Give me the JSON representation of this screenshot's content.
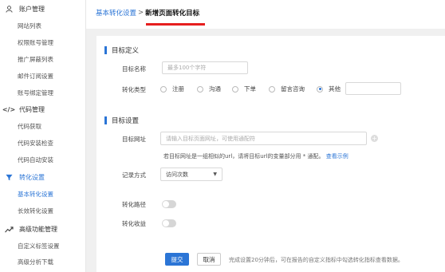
{
  "sidebar": {
    "sections": [
      {
        "label": "账户管理",
        "icon": "user-icon",
        "items": [
          "网站列表",
          "权限账号管理",
          "推广屏蔽列表",
          "邮件订阅设置",
          "账号绑定管理"
        ]
      },
      {
        "label": "代码管理",
        "icon": "code-icon",
        "items": [
          "代码获取",
          "代码安装检查",
          "代码自动安装"
        ]
      },
      {
        "label": "转化设置",
        "icon": "funnel-icon",
        "items": [
          "基本转化设置",
          "长效转化设置"
        ]
      },
      {
        "label": "高级功能管理",
        "icon": "trend-icon",
        "items": [
          "自定义标签设置",
          "高级分析下载"
        ]
      }
    ]
  },
  "breadcrumb": {
    "parent": "基本转化设置",
    "separator": ">",
    "current": "新增页面转化目标"
  },
  "goal_definition": {
    "title": "目标定义",
    "name_label": "目标名称",
    "name_placeholder": "最多100个字符",
    "type_label": "转化类型",
    "type_options": [
      "注册",
      "沟通",
      "下单",
      "留言咨询",
      "其他"
    ],
    "type_selected": "其他"
  },
  "goal_setting": {
    "title": "目标设置",
    "url_label": "目标网址",
    "url_placeholder": "请输入目标页面网址，可使用通配符",
    "hint_text": "若目标网址是一组相似的url，请将目标url的变量部分用 * 通配。",
    "hint_link": "查看示例",
    "record_label": "记录方式",
    "record_value": "访问次数",
    "path_label": "转化路径",
    "revenue_label": "转化收益",
    "path_on": false,
    "revenue_on": false
  },
  "footer": {
    "submit_label": "提交",
    "cancel_label": "取消",
    "note": "完成设置20分钟后，可在报告的自定义指标中勾选转化指标查看数据。"
  },
  "colors": {
    "accent": "#2b75d6",
    "highlight": "#e61e1e"
  }
}
